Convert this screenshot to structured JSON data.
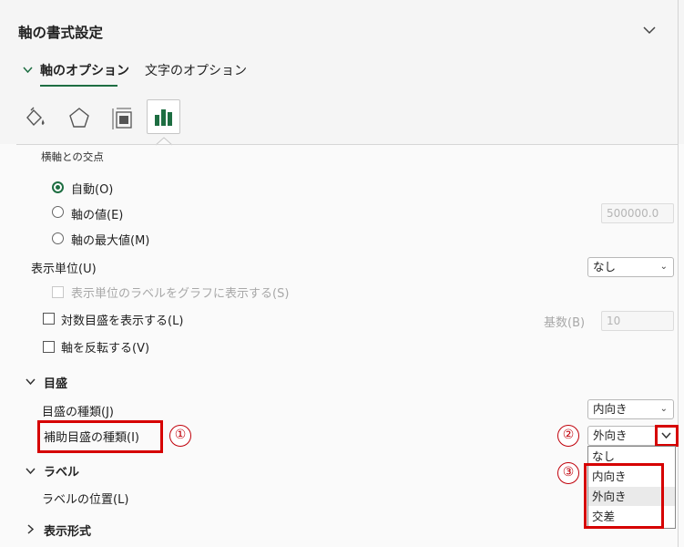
{
  "header": {
    "title": "軸の書式設定"
  },
  "tabs": {
    "axis_options": "軸のオプション",
    "text_options": "文字のオプション"
  },
  "icons": [
    "fill-line-icon",
    "effects-icon",
    "size-properties-icon",
    "axis-options-icon"
  ],
  "axis_cross": {
    "heading": "横軸との交点",
    "auto": "自動(O)",
    "axis_value": "軸の値(E)",
    "axis_value_field": "500000.0",
    "max_value": "軸の最大値(M)",
    "selected": "auto"
  },
  "display_units": {
    "label": "表示単位(U)",
    "value": "なし",
    "show_label": "表示単位のラベルをグラフに表示する(S)"
  },
  "log_scale": {
    "label": "対数目盛を表示する(L)",
    "base_label": "基数(B)",
    "base_value": "10"
  },
  "reverse": {
    "label": "軸を反転する(V)"
  },
  "tick_marks": {
    "section": "目盛",
    "major_label": "目盛の種類(J)",
    "major_value": "内向き",
    "minor_label": "補助目盛の種類(I)",
    "minor_value": "外向き",
    "options": [
      "なし",
      "内向き",
      "外向き",
      "交差"
    ]
  },
  "labels": {
    "section": "ラベル",
    "position_label": "ラベルの位置(L)"
  },
  "number_format": {
    "section": "表示形式"
  },
  "annotations": [
    "①",
    "②",
    "③"
  ],
  "colors": {
    "accent": "#1e6e42",
    "highlight": "#d60000"
  }
}
